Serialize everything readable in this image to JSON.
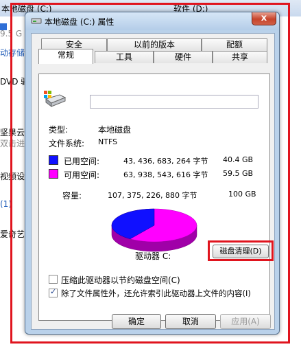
{
  "background": {
    "top_left_text": "本地磁盘 (C:)",
    "top_right_text": "软件 (D:)",
    "left_fragments": [
      "9.5 G",
      "动存储",
      "DVD 驱",
      "坚果云",
      "双击进",
      "视频设",
      "(1)",
      "爱奇艺"
    ]
  },
  "dialog": {
    "title": "本地磁盘 (C:) 属性",
    "close_glyph": "x",
    "tabs_row1": [
      "安全",
      "以前的版本",
      "配额"
    ],
    "tabs_row2": [
      "常规",
      "工具",
      "硬件",
      "共享"
    ],
    "active_tab": "常规",
    "general": {
      "name_value": "",
      "type_label": "类型:",
      "type_value": "本地磁盘",
      "fs_label": "文件系统:",
      "fs_value": "NTFS",
      "used_label": "已用空间:",
      "used_bytes": "43, 436, 683, 264 字节",
      "used_gb": "40.4 GB",
      "free_label": "可用空间:",
      "free_bytes": "63, 938, 543, 616 字节",
      "free_gb": "59.5 GB",
      "capacity_label": "容量:",
      "capacity_bytes": "107, 375, 226, 880 字节",
      "capacity_gb": "100 GB",
      "drive_label": "驱动器 C:",
      "cleanup_button": "磁盘清理(D)",
      "compress_label": "压缩此驱动器以节约磁盘空间(C)",
      "compress_checked": false,
      "index_label": "除了文件属性外，还允许索引此驱动器上文件的内容(I)",
      "index_checked": true,
      "used_fraction": 0.404
    },
    "buttons": {
      "ok": "确定",
      "cancel": "取消",
      "apply": "应用(A)"
    },
    "colors": {
      "used": "#1010ff",
      "free": "#ff00ff"
    }
  }
}
